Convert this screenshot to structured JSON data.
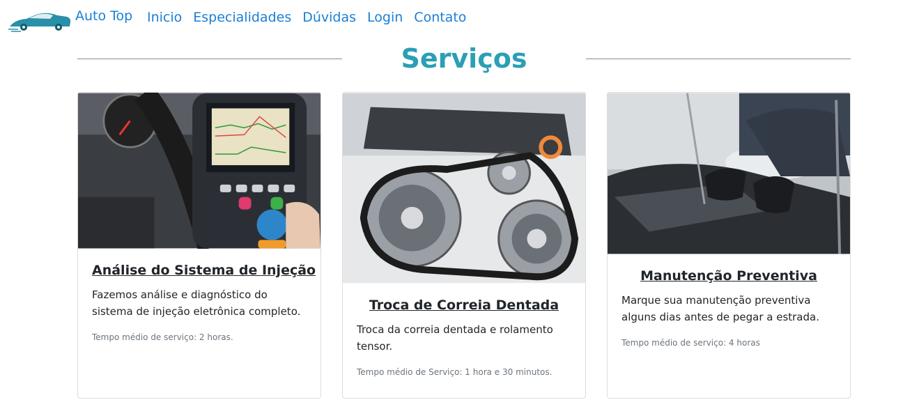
{
  "nav": {
    "brand": "Auto Top",
    "links": [
      "Inicio",
      "Especialidades",
      "Dúvidas",
      "Login",
      "Contato"
    ]
  },
  "section": {
    "title": "Serviços"
  },
  "cards": [
    {
      "title": "Análise do Sistema de Injeção",
      "text": "Fazemos análise e diagnóstico do sistema de injeção eletrônica completo.",
      "meta": "Tempo médio de serviço: 2 horas."
    },
    {
      "title": "Troca de Correia Dentada",
      "text": "Troca da correia dentada e rolamento tensor.",
      "meta": "Tempo médio de Serviço: 1 hora e 30 minutos."
    },
    {
      "title": "Manutenção Preventiva",
      "text": "Marque sua manutenção preventiva alguns dias antes de pegar a estrada.",
      "meta": "Tempo médio de serviço: 4 horas"
    }
  ],
  "colors": {
    "link": "#1a7fd6",
    "title": "#2a9fb5"
  }
}
